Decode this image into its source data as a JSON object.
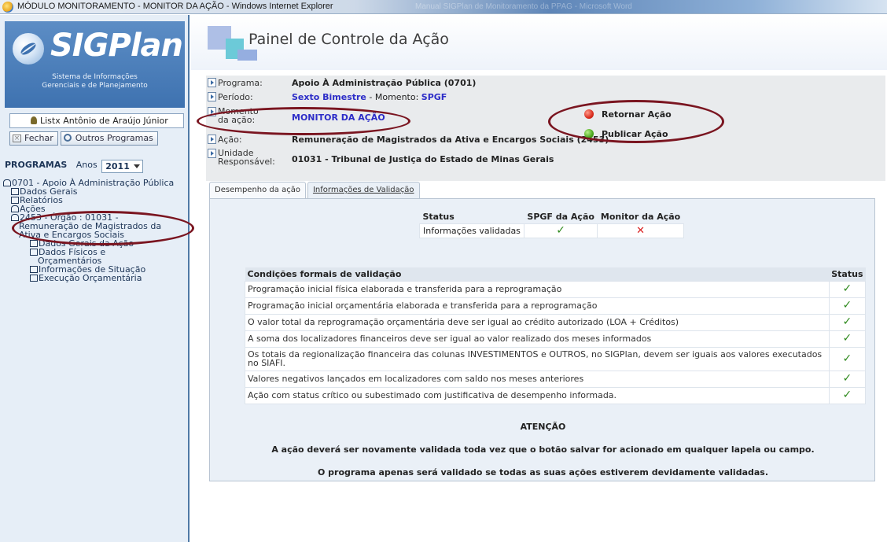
{
  "window": {
    "title": "MÓDULO MONITORAMENTO - MONITOR DA AÇÃO - Windows Internet Explorer",
    "ghost_title": "Manual SIGPlan de Monitoramento da PPAG - Microsoft Word"
  },
  "sidebar": {
    "logo": {
      "name": "SIGPlan",
      "subtitle_line1": "Sistema de Informações",
      "subtitle_line2": "Gerenciais e de Planejamento"
    },
    "user": "Listx Antônio de Araújo Júnior",
    "buttons": {
      "close": "Fechar",
      "other_programs": "Outros Programas"
    },
    "programs_label": "PROGRAMAS",
    "years_label": "Anos",
    "year": "2011",
    "tree": {
      "program": "0701 - Apoio À Administração Pública",
      "dados_gerais": "Dados Gerais",
      "relatorios": "Relatórios",
      "acoes": "Ações",
      "acao": "2453 - Órgão : 01031 - Remuneração de Magistrados da Ativa e Encargos Sociais",
      "dados_gerais_acao": "Dados Gerais da Ação",
      "dados_fisicos": "Dados Físicos e Orçamentários",
      "info_situacao": "Informações de Situação",
      "execucao": "Execução Orçamentária"
    }
  },
  "header": {
    "title_part1": "Painel de",
    "title_part2": "Controle da Ação"
  },
  "info": {
    "programa_label": "Programa:",
    "programa_value": "Apoio À Administração Pública (0701)",
    "periodo_label": "Período:",
    "periodo_value": "Sexto Bimestre",
    "periodo_sep": " - Momento: ",
    "periodo_momento": "SPGF",
    "momento_label1": "Momento",
    "momento_label2": "da ação:",
    "momento_value": "MONITOR DA AÇÃO",
    "acao_label": "Ação:",
    "acao_value": "Remuneração de Magistrados da Ativa e Encargos Sociais (2453)",
    "unidade_label1": "Unidade",
    "unidade_label2": "Responsável:",
    "unidade_value": "01031 - Tribunal de Justiça do Estado de Minas Gerais",
    "btn_retornar": "Retornar Ação",
    "btn_publicar": "Publicar Ação"
  },
  "tabs": [
    "Desempenho da ação",
    "Informações de Validação"
  ],
  "status_table": {
    "headers": [
      "Status",
      "SPGF da Ação",
      "Monitor da Ação"
    ],
    "row": {
      "label": "Informações validadas",
      "spgf": "✓",
      "monitor": "✕"
    }
  },
  "conditions": {
    "header": "Condições formais de validação",
    "status_header": "Status",
    "rows": [
      "Programação inicial física elaborada e transferida para a reprogramação",
      "Programação inicial orçamentária elaborada e transferida para a reprogramação",
      "O valor total da reprogramação orçamentária deve ser igual ao crédito autorizado (LOA + Créditos)",
      "A soma dos localizadores financeiros deve ser igual ao valor realizado dos meses informados",
      "Os totais da regionalização financeira das colunas INVESTIMENTOS e OUTROS, no SIGPlan, devem ser iguais aos valores executados no SIAFI.",
      "Valores negativos lançados em localizadores com saldo nos meses anteriores",
      "Ação com status crítico ou subestimado com justificativa de desempenho informada."
    ],
    "check": "✓"
  },
  "notice": {
    "heading": "ATENÇÃO",
    "line1": "A ação deverá ser novamente validada toda vez que o botão salvar for acionado em qualquer lapela ou campo.",
    "line2": "O programa apenas será validado se todas as suas ações estiverem devidamente validadas."
  },
  "colors": {
    "accent": "#3e72b0",
    "annotation": "#7a1520",
    "check": "#2f8a1e",
    "cross": "#d92020"
  }
}
